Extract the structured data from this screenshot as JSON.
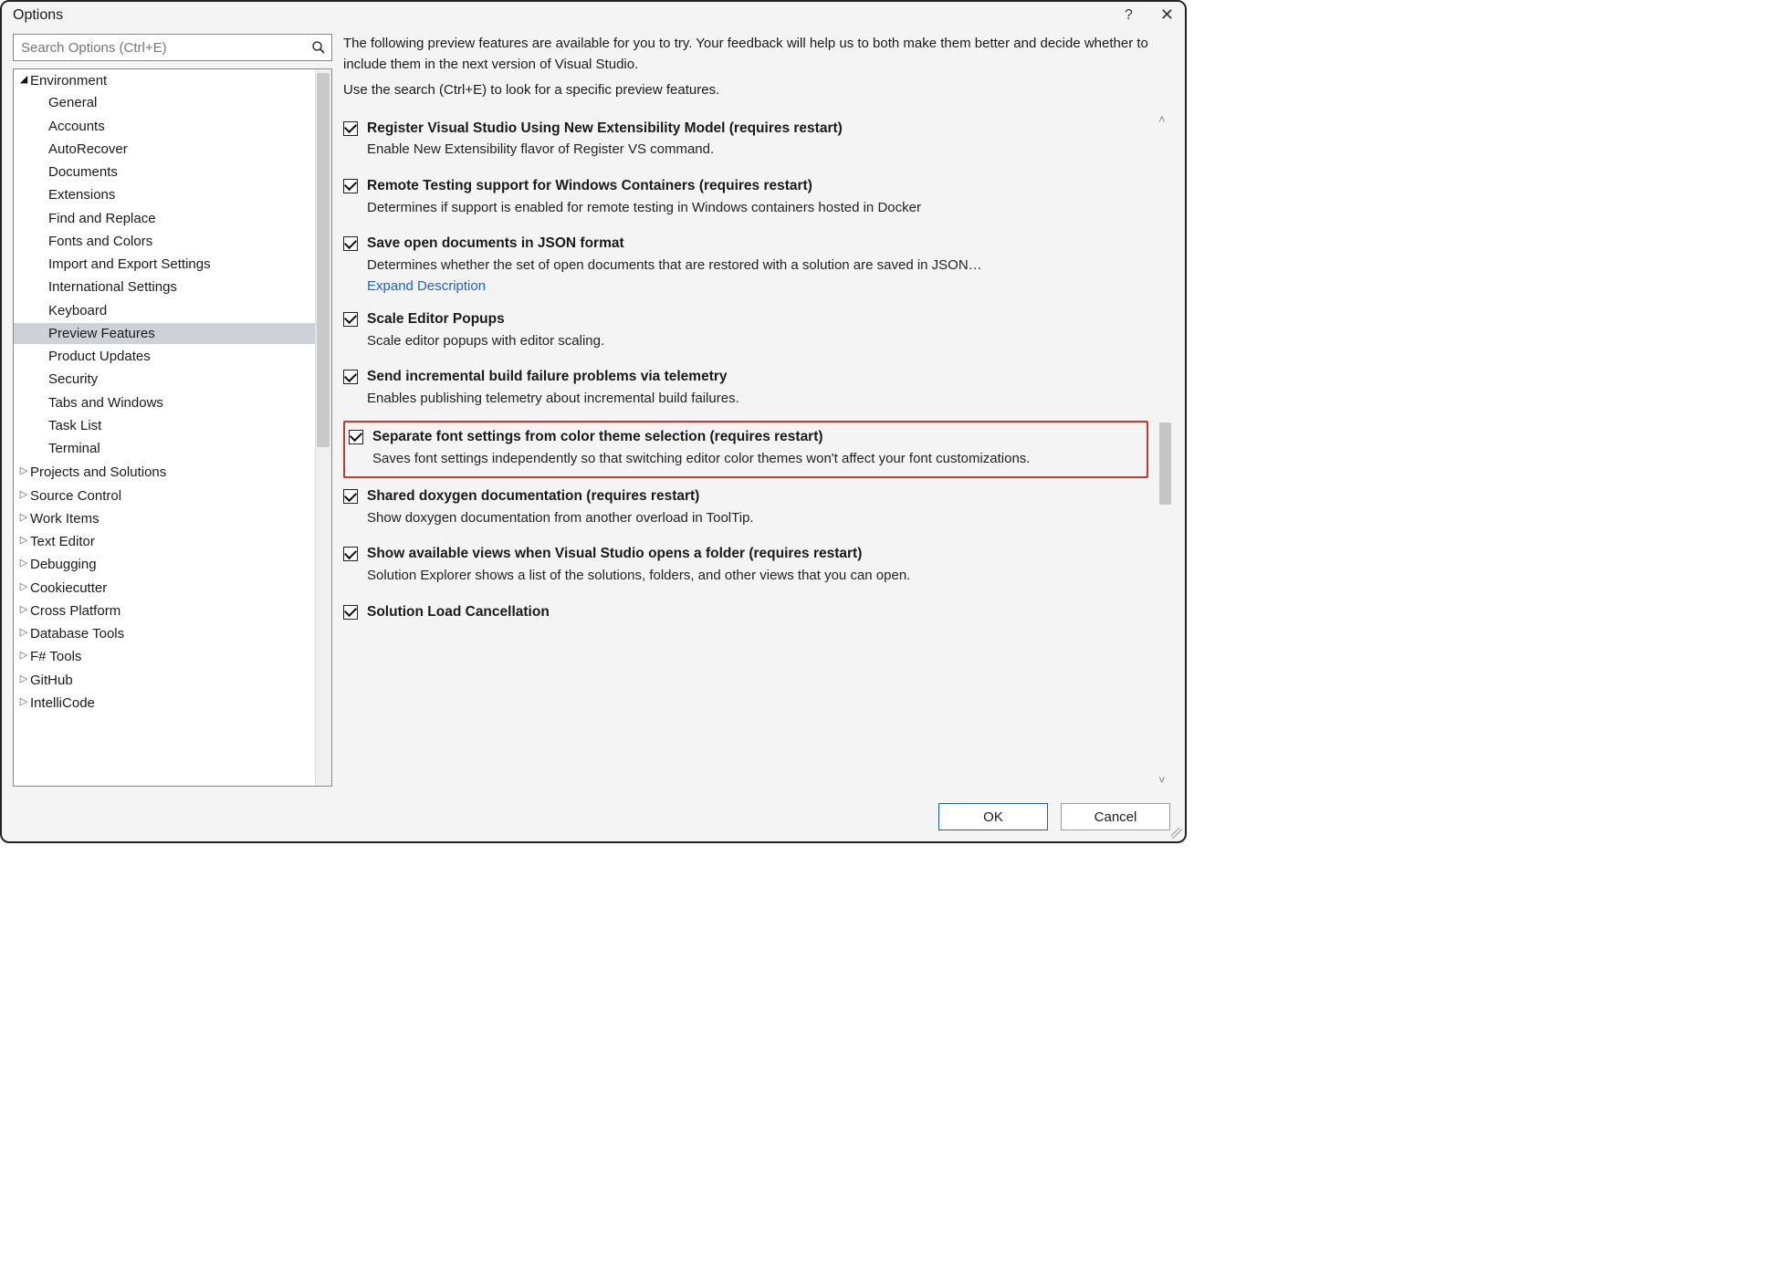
{
  "window": {
    "title": "Options"
  },
  "search": {
    "placeholder": "Search Options (Ctrl+E)"
  },
  "tree": {
    "environment": {
      "label": "Environment",
      "expanded": true,
      "children": [
        "General",
        "Accounts",
        "AutoRecover",
        "Documents",
        "Extensions",
        "Find and Replace",
        "Fonts and Colors",
        "Import and Export Settings",
        "International Settings",
        "Keyboard",
        "Preview Features",
        "Product Updates",
        "Security",
        "Tabs and Windows",
        "Task List",
        "Terminal"
      ],
      "selected": "Preview Features"
    },
    "others": [
      "Projects and Solutions",
      "Source Control",
      "Work Items",
      "Text Editor",
      "Debugging",
      "Cookiecutter",
      "Cross Platform",
      "Database Tools",
      "F# Tools",
      "GitHub",
      "IntelliCode"
    ]
  },
  "content": {
    "intro1": "The following preview features are available for you to try. Your feedback will help us to both make them better and decide whether to include them in the next version of Visual Studio.",
    "intro2": "Use the search (Ctrl+E) to look for a specific preview features.",
    "expand_label": "Expand Description",
    "features": [
      {
        "id": "register-vs",
        "checked": true,
        "title": "Register Visual Studio Using New Extensibility Model (requires restart)",
        "desc": "Enable New Extensibility flavor of Register VS command."
      },
      {
        "id": "remote-testing",
        "checked": true,
        "title": "Remote Testing support for Windows Containers (requires restart)",
        "desc": "Determines if support is enabled for remote testing in Windows containers hosted in Docker"
      },
      {
        "id": "save-json",
        "checked": true,
        "expand": true,
        "title": "Save open documents in JSON format",
        "desc": "Determines whether the set of open documents that are restored with a solution are saved in JSON…"
      },
      {
        "id": "scale-popups",
        "checked": true,
        "title": "Scale Editor Popups",
        "desc": "Scale editor popups with editor scaling."
      },
      {
        "id": "telemetry",
        "checked": true,
        "title": "Send incremental build failure problems via telemetry",
        "desc": "Enables publishing telemetry about incremental build failures."
      },
      {
        "id": "font-separate",
        "checked": true,
        "highlight": true,
        "title": "Separate font settings from color theme selection (requires restart)",
        "desc": "Saves font settings independently so that switching editor color themes won't affect your font customizations."
      },
      {
        "id": "doxygen",
        "checked": true,
        "title": "Shared doxygen documentation (requires restart)",
        "desc": "Show doxygen documentation from another overload in ToolTip."
      },
      {
        "id": "folder-views",
        "checked": true,
        "title": "Show available views when Visual Studio opens a folder (requires restart)",
        "desc": "Solution Explorer shows a list of the solutions, folders, and other views that you can open."
      },
      {
        "id": "sln-cancel",
        "checked": true,
        "title": "Solution Load Cancellation",
        "desc": ""
      }
    ]
  },
  "buttons": {
    "ok": "OK",
    "cancel": "Cancel"
  }
}
